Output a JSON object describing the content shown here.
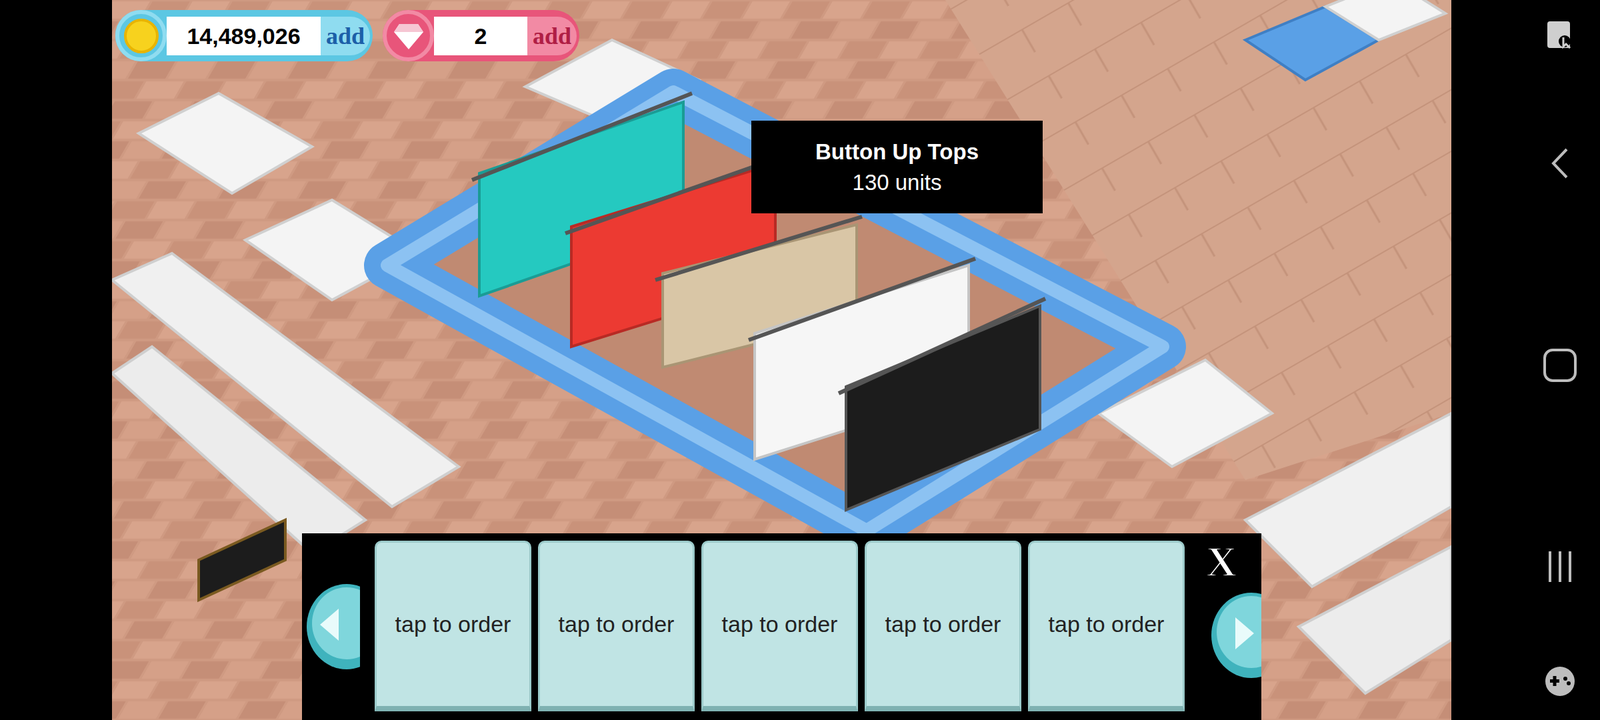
{
  "hud": {
    "coins": {
      "value": "14,489,026",
      "add": "add"
    },
    "gems": {
      "value": "2",
      "add": "add"
    }
  },
  "tooltip": {
    "title": "Button Up Tops",
    "subtitle": "130 units"
  },
  "order_panel": {
    "slots": [
      {
        "label": "tap to order"
      },
      {
        "label": "tap to order"
      },
      {
        "label": "tap to order"
      },
      {
        "label": "tap to order"
      },
      {
        "label": "tap to order"
      }
    ],
    "close": "X"
  }
}
